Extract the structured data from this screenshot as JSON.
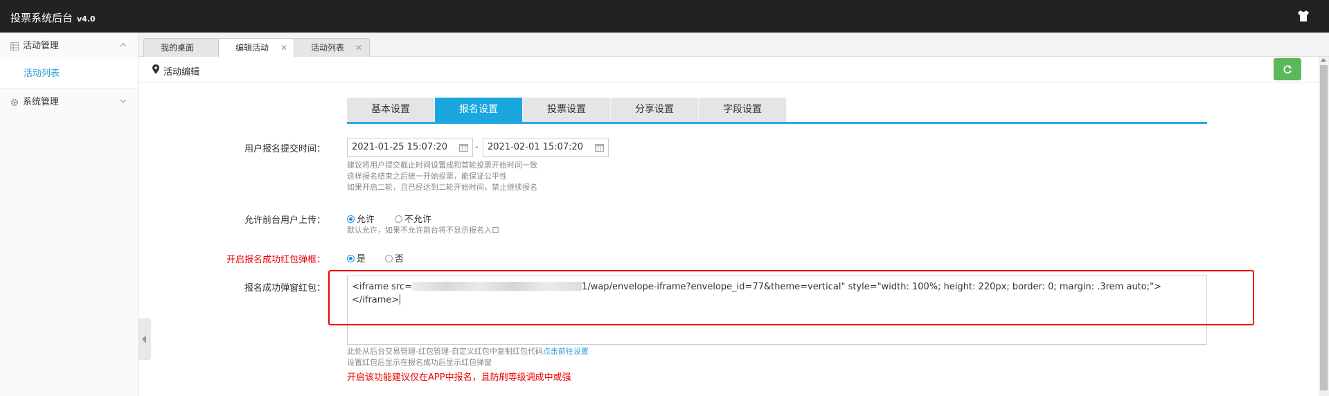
{
  "header": {
    "title": "投票系统后台",
    "version": "v4.0",
    "right_icon": "tshirt-icon"
  },
  "sidebar": {
    "groups": [
      {
        "label": "活动管理",
        "icon": "grid-icon",
        "expanded": true,
        "items": [
          {
            "label": "活动列表"
          }
        ]
      },
      {
        "label": "系统管理",
        "icon": "gear-icon",
        "expanded": false,
        "items": []
      }
    ]
  },
  "tabs": [
    {
      "label": "我的桌面",
      "closable": false
    },
    {
      "label": "编辑活动",
      "closable": true,
      "active": true
    },
    {
      "label": "活动列表",
      "closable": true
    }
  ],
  "breadcrumb": {
    "label": "活动编辑",
    "icon": "map-pin-icon"
  },
  "refresh_icon": "refresh-icon",
  "subtabs": [
    {
      "label": "基本设置"
    },
    {
      "label": "报名设置",
      "active": true
    },
    {
      "label": "投票设置"
    },
    {
      "label": "分享设置"
    },
    {
      "label": "字段设置"
    }
  ],
  "form": {
    "submit_time": {
      "label": "用户报名提交时间：",
      "start": "2021-01-25 15:07:20",
      "separator": "-",
      "end": "2021-02-01 15:07:20",
      "hints": [
        "建议将用户提交截止时间设置成和首轮投票开始时间一致",
        "这样报名结束之后统一开始投票，能保证公平性",
        "如果开启二轮，且已经达到二轮开始时间，禁止继续报名"
      ]
    },
    "allow_upload": {
      "label": "允许前台用户上传：",
      "options": [
        "允许",
        "不允许"
      ],
      "selected": "允许",
      "hint": "默认允许，如果不允许前台将不显示报名入口"
    },
    "red_packet_popup": {
      "label": "开启报名成功红包弹框：",
      "options": [
        "是",
        "否"
      ],
      "selected": "是"
    },
    "red_packet_code": {
      "label": "报名成功弹窗红包：",
      "value_line1_prefix": "<iframe src=",
      "value_line1_suffix": "1/wap/envelope-iframe?envelope_id=77&theme=vertical\" style=\"width: 100%; height: 220px; border: 0; margin: .3rem auto;\">",
      "value_line2": "</iframe>",
      "hint_line1": "此处从后台交易管理-红包管理-自定义红包中复制红包代码",
      "hint_link": "点击前往设置",
      "hint_line2": "设置红包后显示在报名成功后显示红包弹窗",
      "warning": "开启该功能建议仅在APP中报名，且防刷等级调成中或强"
    }
  },
  "colors": {
    "accent": "#19a7e0",
    "header_bg": "#222222",
    "highlight_box": "#ee0000",
    "refresh_bg": "#5cb85c",
    "link": "#2a9fd6"
  }
}
